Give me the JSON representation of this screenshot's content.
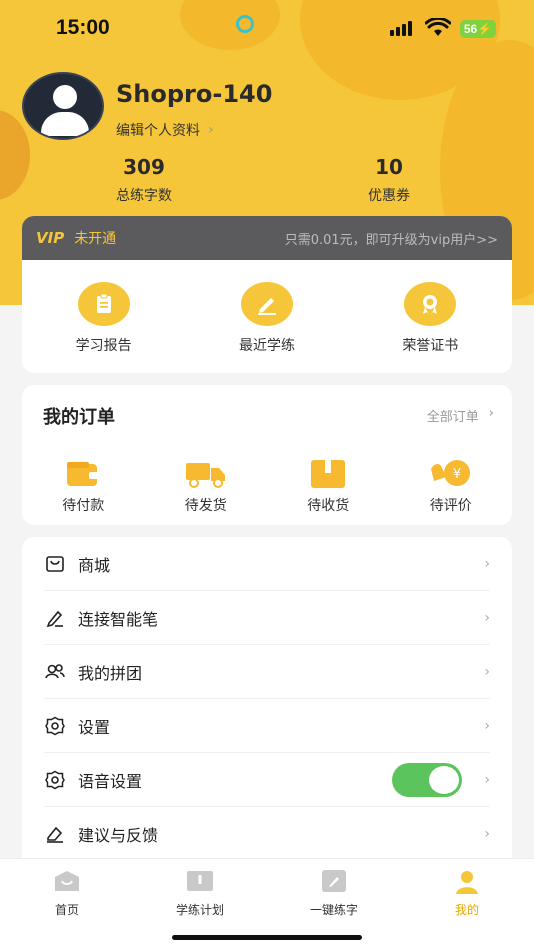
{
  "status_bar": {
    "time": "15:00",
    "battery": "56"
  },
  "profile": {
    "username": "Shopro-140",
    "edit_label": "编辑个人资料"
  },
  "stats": [
    {
      "value": "309",
      "label": "总练字数"
    },
    {
      "value": "10",
      "label": "优惠券"
    }
  ],
  "vip": {
    "logo": "VIP",
    "status": "未开通",
    "promo": "只需0.01元，即可升级为vip用户>>"
  },
  "quick_actions": [
    {
      "label": "学习报告",
      "icon": "clipboard-icon"
    },
    {
      "label": "最近学练",
      "icon": "pen-icon"
    },
    {
      "label": "荣誉证书",
      "icon": "badge-icon"
    }
  ],
  "orders": {
    "title": "我的订单",
    "all_label": "全部订单",
    "items": [
      {
        "label": "待付款",
        "icon": "wallet-icon"
      },
      {
        "label": "待发货",
        "icon": "truck-icon"
      },
      {
        "label": "待收货",
        "icon": "box-icon"
      },
      {
        "label": "待评价",
        "icon": "review-icon"
      }
    ]
  },
  "menu": [
    {
      "label": "商城",
      "icon": "shop-icon"
    },
    {
      "label": "连接智能笔",
      "icon": "pen-icon"
    },
    {
      "label": "我的拼团",
      "icon": "group-icon"
    },
    {
      "label": "设置",
      "icon": "gear-icon"
    },
    {
      "label": "语音设置",
      "icon": "gear-icon",
      "toggle_on": true
    },
    {
      "label": "建议与反馈",
      "icon": "feedback-icon"
    }
  ],
  "tabs": [
    {
      "label": "首页",
      "icon": "home-icon"
    },
    {
      "label": "学练计划",
      "icon": "book-icon"
    },
    {
      "label": "一键练字",
      "icon": "write-icon"
    },
    {
      "label": "我的",
      "icon": "person-icon",
      "active": true
    }
  ],
  "colors": {
    "accent": "#f6c63a",
    "toggle": "#5cc45c",
    "vip_bar": "#5b5b5d"
  }
}
